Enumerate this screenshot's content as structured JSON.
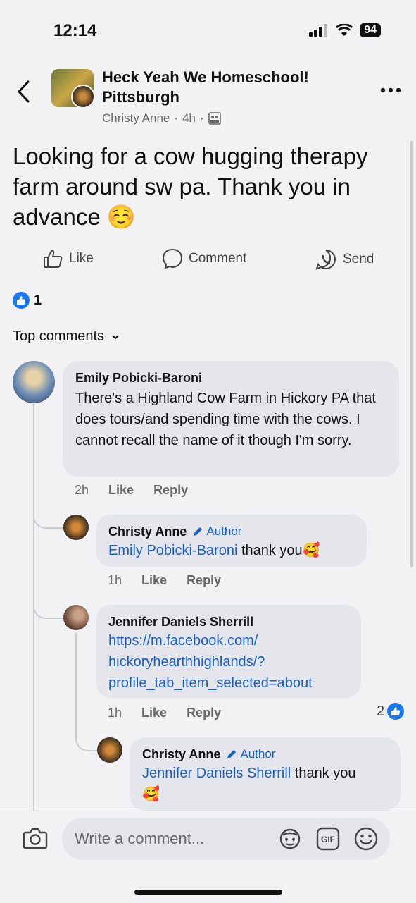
{
  "status": {
    "time": "12:14",
    "battery": "94"
  },
  "header": {
    "group_name": "Heck Yeah We Homeschool! Pittsburgh",
    "group_name_line1": "Heck Yeah We Homeschool!",
    "group_name_line2": "Pittsburgh",
    "author": "Christy Anne",
    "time": "4h"
  },
  "post": {
    "text": "Looking for a cow hugging therapy farm around sw pa. Thank you in advance ☺️",
    "actions": {
      "like": "Like",
      "comment": "Comment",
      "send": "Send"
    },
    "like_count": "1"
  },
  "comments_filter": "Top comments",
  "comments": [
    {
      "name": "Emily Pobicki-Baroni",
      "text": "There's a Highland Cow Farm in Hickory PA that does tours/and spending time with the cows. I cannot recall the name of it though I'm sorry.",
      "time": "2h",
      "like": "Like",
      "reply": "Reply"
    },
    {
      "name": "Christy Anne",
      "badge": "Author",
      "mention": "Emily Pobicki-Baroni",
      "text": " thank you🥰",
      "time": "1h",
      "like": "Like",
      "reply": "Reply"
    },
    {
      "name": "Jennifer Daniels Sherrill",
      "link_line1": "https://m.facebook.com/",
      "link_line2": "hickoryhearthhighlands/?",
      "link_line3": "profile_tab_item_selected=about",
      "time": "1h",
      "like": "Like",
      "reply": "Reply",
      "reaction_count": "2"
    },
    {
      "name": "Christy Anne",
      "badge": "Author",
      "mention": "Jennifer Daniels Sherrill",
      "text": " thank you",
      "emoji": "🥰"
    }
  ],
  "composer": {
    "placeholder": "Write a comment..."
  },
  "icons": [
    "back-chevron-icon",
    "more-icon",
    "camera-icon",
    "avatar-sticker-icon",
    "gif-icon",
    "emoji-icon",
    "like-thumb-icon",
    "comment-bubble-icon",
    "whatsapp-send-icon",
    "pencil-icon"
  ],
  "colors": {
    "accent": "#1877f2",
    "link": "#1a5ec8",
    "bubble": "#e4e6eb",
    "background": "#f2f2f4"
  }
}
